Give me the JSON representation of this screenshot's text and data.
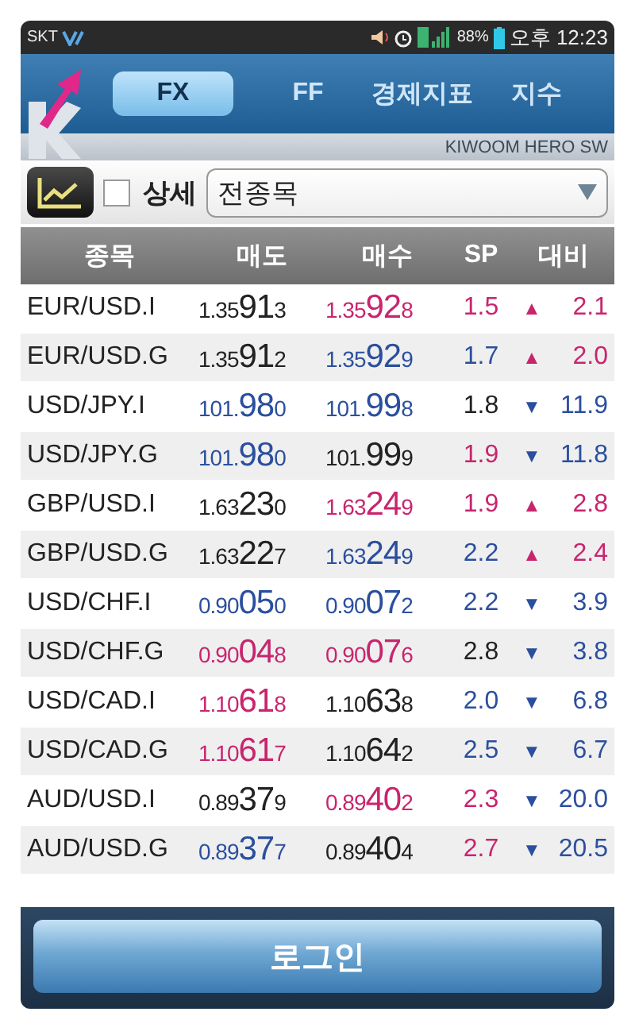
{
  "status_bar": {
    "carrier": "SKT",
    "battery": "88%",
    "time": "오후 12:23"
  },
  "tabs": [
    {
      "label": "FX",
      "selected": true
    },
    {
      "label": "FF",
      "selected": false
    },
    {
      "label": "경제지표",
      "selected": false
    },
    {
      "label": "지수",
      "selected": false
    }
  ],
  "brand": "KIWOOM HERO SW",
  "toolbar": {
    "detail_label": "상세",
    "detail_checked": false,
    "filter": "전종목"
  },
  "table": {
    "columns": [
      "종목",
      "매도",
      "매수",
      "SP",
      "대비"
    ],
    "rows": [
      {
        "name": "EUR/USD.I",
        "sell": {
          "head": "1.35",
          "big": "91",
          "tail": "3",
          "color": "#222222"
        },
        "buy": {
          "head": "1.35",
          "big": "92",
          "tail": "8",
          "color": "#c8256e"
        },
        "sp": {
          "text": "1.5",
          "color": "#c8256e"
        },
        "change": {
          "arrow": "▲",
          "value": "2.1",
          "color": "#c8256e"
        }
      },
      {
        "name": "EUR/USD.G",
        "sell": {
          "head": "1.35",
          "big": "91",
          "tail": "2",
          "color": "#222222"
        },
        "buy": {
          "head": "1.35",
          "big": "92",
          "tail": "9",
          "color": "#2b4f9e"
        },
        "sp": {
          "text": "1.7",
          "color": "#2b4f9e"
        },
        "change": {
          "arrow": "▲",
          "value": "2.0",
          "color": "#c8256e"
        }
      },
      {
        "name": "USD/JPY.I",
        "sell": {
          "head": "101.",
          "big": "98",
          "tail": "0",
          "color": "#2b4f9e"
        },
        "buy": {
          "head": "101.",
          "big": "99",
          "tail": "8",
          "color": "#2b4f9e"
        },
        "sp": {
          "text": "1.8",
          "color": "#222222"
        },
        "change": {
          "arrow": "▼",
          "value": "11.9",
          "color": "#2b4f9e"
        }
      },
      {
        "name": "USD/JPY.G",
        "sell": {
          "head": "101.",
          "big": "98",
          "tail": "0",
          "color": "#2b4f9e"
        },
        "buy": {
          "head": "101.",
          "big": "99",
          "tail": "9",
          "color": "#222222"
        },
        "sp": {
          "text": "1.9",
          "color": "#c8256e"
        },
        "change": {
          "arrow": "▼",
          "value": "11.8",
          "color": "#2b4f9e"
        }
      },
      {
        "name": "GBP/USD.I",
        "sell": {
          "head": "1.63",
          "big": "23",
          "tail": "0",
          "color": "#222222"
        },
        "buy": {
          "head": "1.63",
          "big": "24",
          "tail": "9",
          "color": "#c8256e"
        },
        "sp": {
          "text": "1.9",
          "color": "#c8256e"
        },
        "change": {
          "arrow": "▲",
          "value": "2.8",
          "color": "#c8256e"
        }
      },
      {
        "name": "GBP/USD.G",
        "sell": {
          "head": "1.63",
          "big": "22",
          "tail": "7",
          "color": "#222222"
        },
        "buy": {
          "head": "1.63",
          "big": "24",
          "tail": "9",
          "color": "#2b4f9e"
        },
        "sp": {
          "text": "2.2",
          "color": "#2b4f9e"
        },
        "change": {
          "arrow": "▲",
          "value": "2.4",
          "color": "#c8256e"
        }
      },
      {
        "name": "USD/CHF.I",
        "sell": {
          "head": "0.90",
          "big": "05",
          "tail": "0",
          "color": "#2b4f9e"
        },
        "buy": {
          "head": "0.90",
          "big": "07",
          "tail": "2",
          "color": "#2b4f9e"
        },
        "sp": {
          "text": "2.2",
          "color": "#2b4f9e"
        },
        "change": {
          "arrow": "▼",
          "value": "3.9",
          "color": "#2b4f9e"
        }
      },
      {
        "name": "USD/CHF.G",
        "sell": {
          "head": "0.90",
          "big": "04",
          "tail": "8",
          "color": "#c8256e"
        },
        "buy": {
          "head": "0.90",
          "big": "07",
          "tail": "6",
          "color": "#c8256e"
        },
        "sp": {
          "text": "2.8",
          "color": "#222222"
        },
        "change": {
          "arrow": "▼",
          "value": "3.8",
          "color": "#2b4f9e"
        }
      },
      {
        "name": "USD/CAD.I",
        "sell": {
          "head": "1.10",
          "big": "61",
          "tail": "8",
          "color": "#c8256e"
        },
        "buy": {
          "head": "1.10",
          "big": "63",
          "tail": "8",
          "color": "#222222"
        },
        "sp": {
          "text": "2.0",
          "color": "#2b4f9e"
        },
        "change": {
          "arrow": "▼",
          "value": "6.8",
          "color": "#2b4f9e"
        }
      },
      {
        "name": "USD/CAD.G",
        "sell": {
          "head": "1.10",
          "big": "61",
          "tail": "7",
          "color": "#c8256e"
        },
        "buy": {
          "head": "1.10",
          "big": "64",
          "tail": "2",
          "color": "#222222"
        },
        "sp": {
          "text": "2.5",
          "color": "#2b4f9e"
        },
        "change": {
          "arrow": "▼",
          "value": "6.7",
          "color": "#2b4f9e"
        }
      },
      {
        "name": "AUD/USD.I",
        "sell": {
          "head": "0.89",
          "big": "37",
          "tail": "9",
          "color": "#222222"
        },
        "buy": {
          "head": "0.89",
          "big": "40",
          "tail": "2",
          "color": "#c8256e"
        },
        "sp": {
          "text": "2.3",
          "color": "#c8256e"
        },
        "change": {
          "arrow": "▼",
          "value": "20.0",
          "color": "#2b4f9e"
        }
      },
      {
        "name": "AUD/USD.G",
        "sell": {
          "head": "0.89",
          "big": "37",
          "tail": "7",
          "color": "#2b4f9e"
        },
        "buy": {
          "head": "0.89",
          "big": "40",
          "tail": "4",
          "color": "#222222"
        },
        "sp": {
          "text": "2.7",
          "color": "#c8256e"
        },
        "change": {
          "arrow": "▼",
          "value": "20.5",
          "color": "#2b4f9e"
        }
      }
    ]
  },
  "login_button": "로그인"
}
